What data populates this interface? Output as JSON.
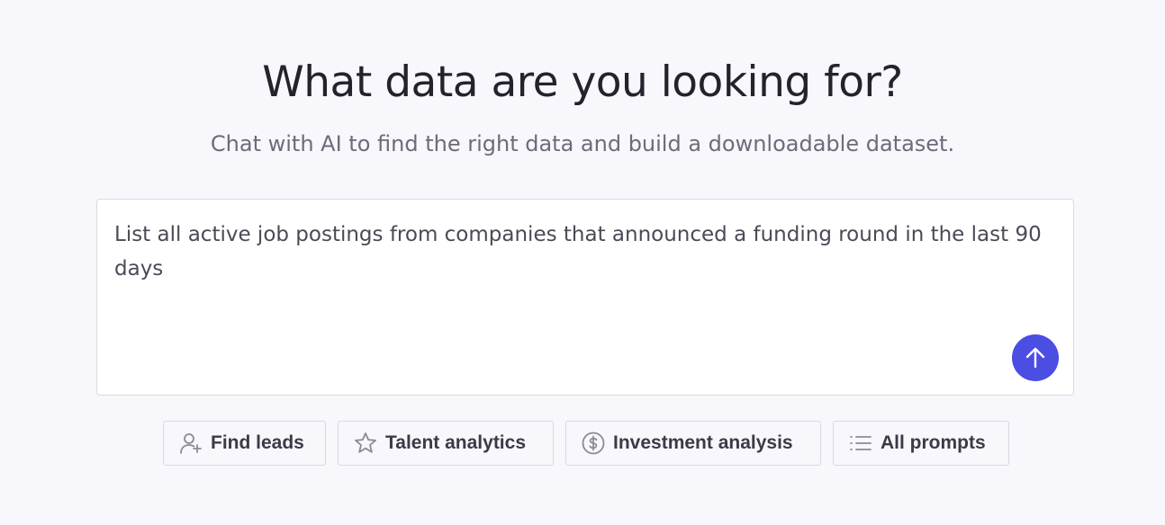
{
  "header": {
    "title": "What data are you looking for?",
    "subtitle": "Chat with AI to find the right data and build a downloadable dataset."
  },
  "prompt": {
    "value": "List all active job postings from companies that announced a funding round in the last 90 days",
    "send_icon": "arrow-up-icon"
  },
  "chips": [
    {
      "label": "Find leads",
      "icon": "add-user-icon"
    },
    {
      "label": "Talent analytics",
      "icon": "star-icon"
    },
    {
      "label": "Investment analysis",
      "icon": "dollar-circle-icon"
    },
    {
      "label": "All prompts",
      "icon": "list-icon"
    }
  ],
  "colors": {
    "accent": "#4b4de3",
    "background": "#f7f7fc",
    "border": "#d9d9e2"
  }
}
